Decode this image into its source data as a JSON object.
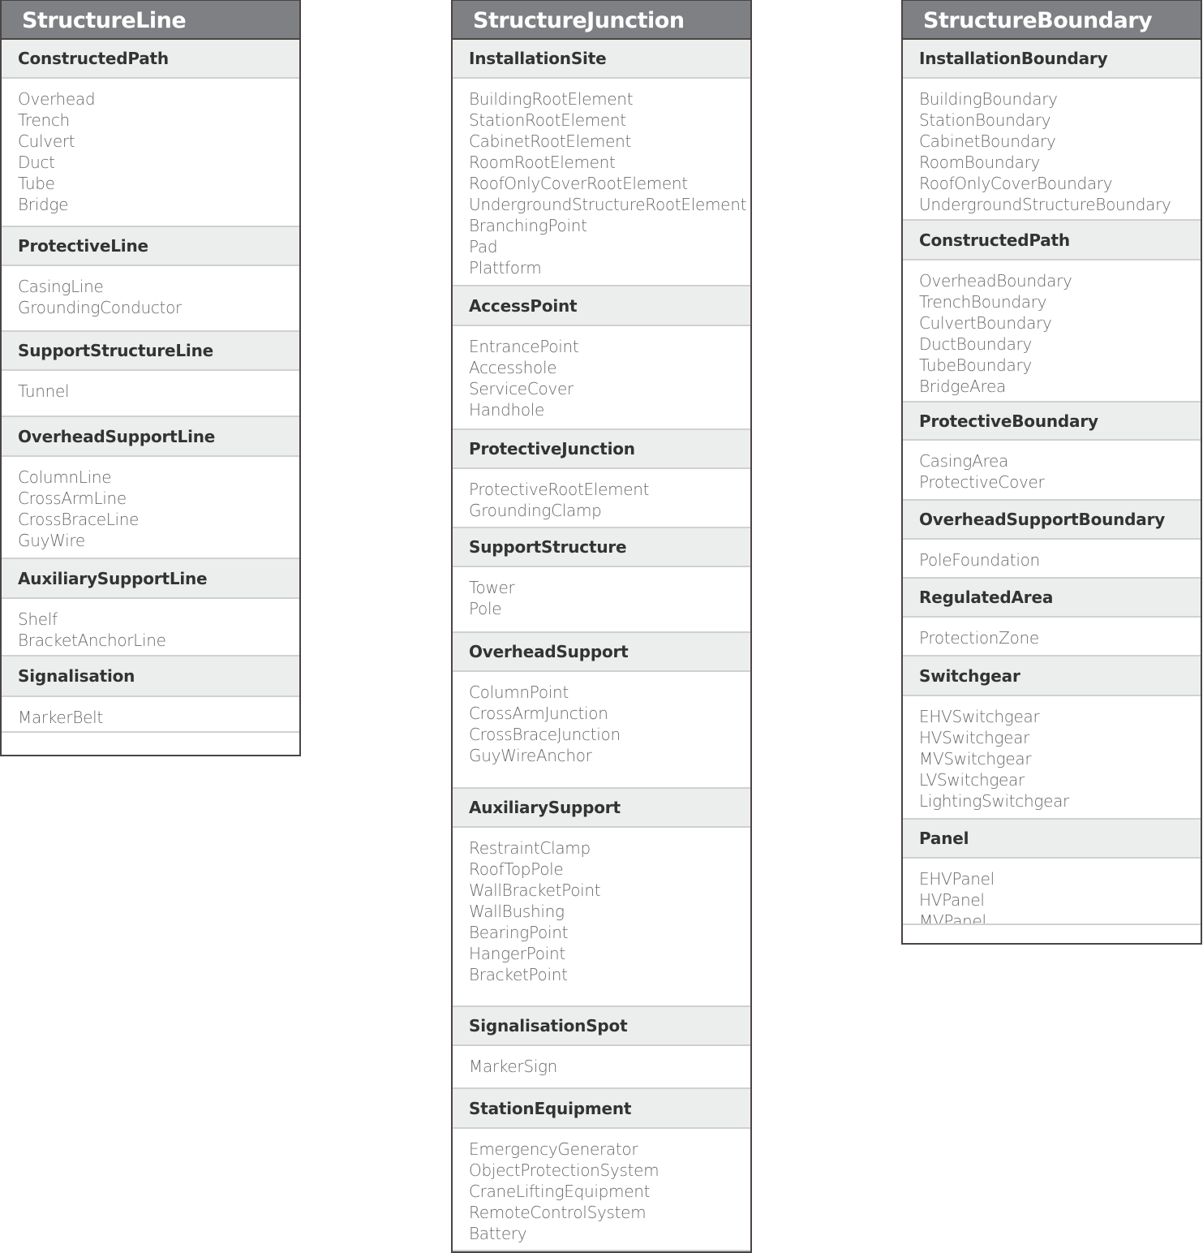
{
  "columns": [
    {
      "title": "StructureLine",
      "sections": [
        {
          "name": "ConstructedPath",
          "items": [
            "Overhead",
            "Trench",
            "Culvert",
            "Duct",
            "Tube",
            "Bridge"
          ]
        },
        {
          "name": "ProtectiveLine",
          "items": [
            "CasingLine",
            "GroundingConductor"
          ]
        },
        {
          "name": "SupportStructureLine",
          "items": [
            "Tunnel"
          ]
        },
        {
          "name": "OverheadSupportLine",
          "items": [
            "ColumnLine",
            "CrossArmLine",
            "CrossBraceLine",
            "GuyWire"
          ]
        },
        {
          "name": "AuxiliarySupportLine",
          "items": [
            "Shelf",
            "BracketAnchorLine"
          ]
        },
        {
          "name": "Signalisation",
          "items": [
            "MarkerBelt"
          ]
        }
      ]
    },
    {
      "title": "StructureJunction",
      "sections": [
        {
          "name": "InstallationSite",
          "items": [
            "BuildingRootElement",
            "StationRootElement",
            "CabinetRootElement",
            "RoomRootElement",
            "RoofOnlyCoverRootElement",
            "UndergroundStructureRootElement",
            "BranchingPoint",
            "Pad",
            "Plattform"
          ]
        },
        {
          "name": "AccessPoint",
          "items": [
            "EntrancePoint",
            "Accesshole",
            "ServiceCover",
            "Handhole"
          ]
        },
        {
          "name": "ProtectiveJunction",
          "items": [
            "ProtectiveRootElement",
            "GroundingClamp"
          ]
        },
        {
          "name": "SupportStructure",
          "items": [
            "Tower",
            "Pole"
          ]
        },
        {
          "name": "OverheadSupport",
          "items": [
            "ColumnPoint",
            "CrossArmJunction",
            "CrossBraceJunction",
            "GuyWireAnchor"
          ]
        },
        {
          "name": "AuxiliarySupport",
          "items": [
            "RestraintClamp",
            "RoofTopPole",
            "WallBracketPoint",
            "WallBushing",
            "BearingPoint",
            "HangerPoint",
            "BracketPoint"
          ]
        },
        {
          "name": "SignalisationSpot",
          "items": [
            "MarkerSign"
          ]
        },
        {
          "name": "StationEquipment",
          "items": [
            "EmergencyGenerator",
            "ObjectProtectionSystem",
            "CraneLiftingEquipment",
            "RemoteControlSystem",
            "Battery"
          ]
        }
      ]
    },
    {
      "title": "StructureBoundary",
      "sections": [
        {
          "name": "InstallationBoundary",
          "items": [
            "BuildingBoundary",
            "StationBoundary",
            "CabinetBoundary",
            "RoomBoundary",
            "RoofOnlyCoverBoundary",
            "UndergroundStructureBoundary"
          ]
        },
        {
          "name": "ConstructedPath",
          "items": [
            "OverheadBoundary",
            "TrenchBoundary",
            "CulvertBoundary",
            "DuctBoundary",
            "TubeBoundary",
            "BridgeArea"
          ]
        },
        {
          "name": "ProtectiveBoundary",
          "items": [
            "CasingArea",
            "ProtectiveCover"
          ]
        },
        {
          "name": "OverheadSupportBoundary",
          "items": [
            "PoleFoundation"
          ]
        },
        {
          "name": "RegulatedArea",
          "items": [
            "ProtectionZone"
          ]
        },
        {
          "name": "Switchgear",
          "items": [
            "EHVSwitchgear",
            "HVSwitchgear",
            "MVSwitchgear",
            "LVSwitchgear",
            "LightingSwitchgear"
          ]
        },
        {
          "name": "Panel",
          "items": [
            "EHVPanel",
            "HVPanel",
            "MVPanel"
          ]
        }
      ]
    }
  ],
  "colors": {
    "title_bg": "#7f8084",
    "section_bg": "#eceeed",
    "border": "#4a4543"
  }
}
